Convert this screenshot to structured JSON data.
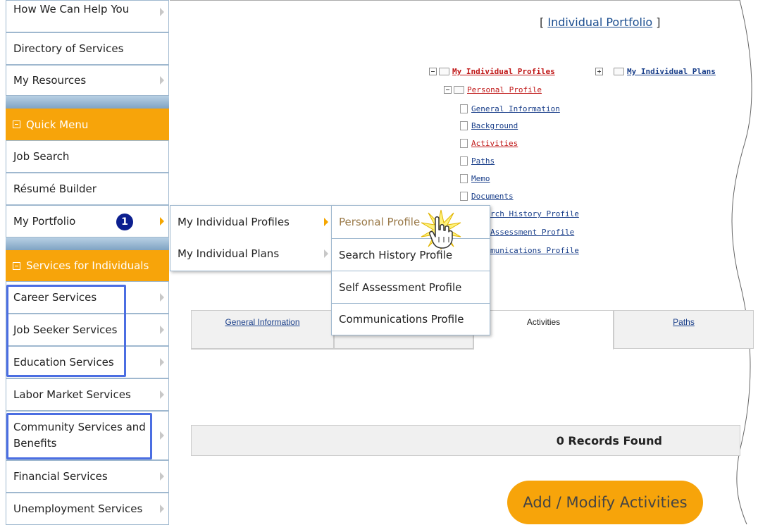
{
  "sidebar": {
    "top_items": [
      "How We Can Help You",
      "Directory of Services",
      "My Resources"
    ],
    "quick_menu_header": "Quick Menu",
    "quick_items": [
      "Job Search",
      "Résumé Builder",
      "My Portfolio"
    ],
    "services_header": "Services for Individuals",
    "service_items": [
      "Career Services",
      "Job Seeker Services",
      "Education Services",
      "Labor Market Services",
      "Community Services and Benefits",
      "Financial Services",
      "Unemployment Services"
    ]
  },
  "callout_badge": "1",
  "flyout1": [
    "My Individual Profiles",
    "My Individual Plans"
  ],
  "flyout2": [
    "Personal Profile",
    "Search History Profile",
    "Self Assessment Profile",
    "Communications Profile"
  ],
  "portfolio": {
    "open": "[",
    "link": "Individual Portfolio",
    "close": "]"
  },
  "tree": {
    "root1": "My Individual Profiles",
    "root2": "My Individual Plans",
    "child": "Personal Profile",
    "leaves": [
      "General Information",
      "Background",
      "Activities",
      "Paths",
      "Memo",
      "Documents"
    ],
    "partial": [
      "rch History Profile",
      "Assessment Profile",
      "munications Profile"
    ]
  },
  "tabs": [
    "General Information",
    "Activities",
    "Paths"
  ],
  "records_text": "0 Records Found",
  "add_button": "Add / Modify Activities",
  "colors": {
    "orange": "#f7a40a",
    "link": "#1a3f8a",
    "red_link": "#c01818",
    "highlight_box": "#4b6ee2"
  }
}
